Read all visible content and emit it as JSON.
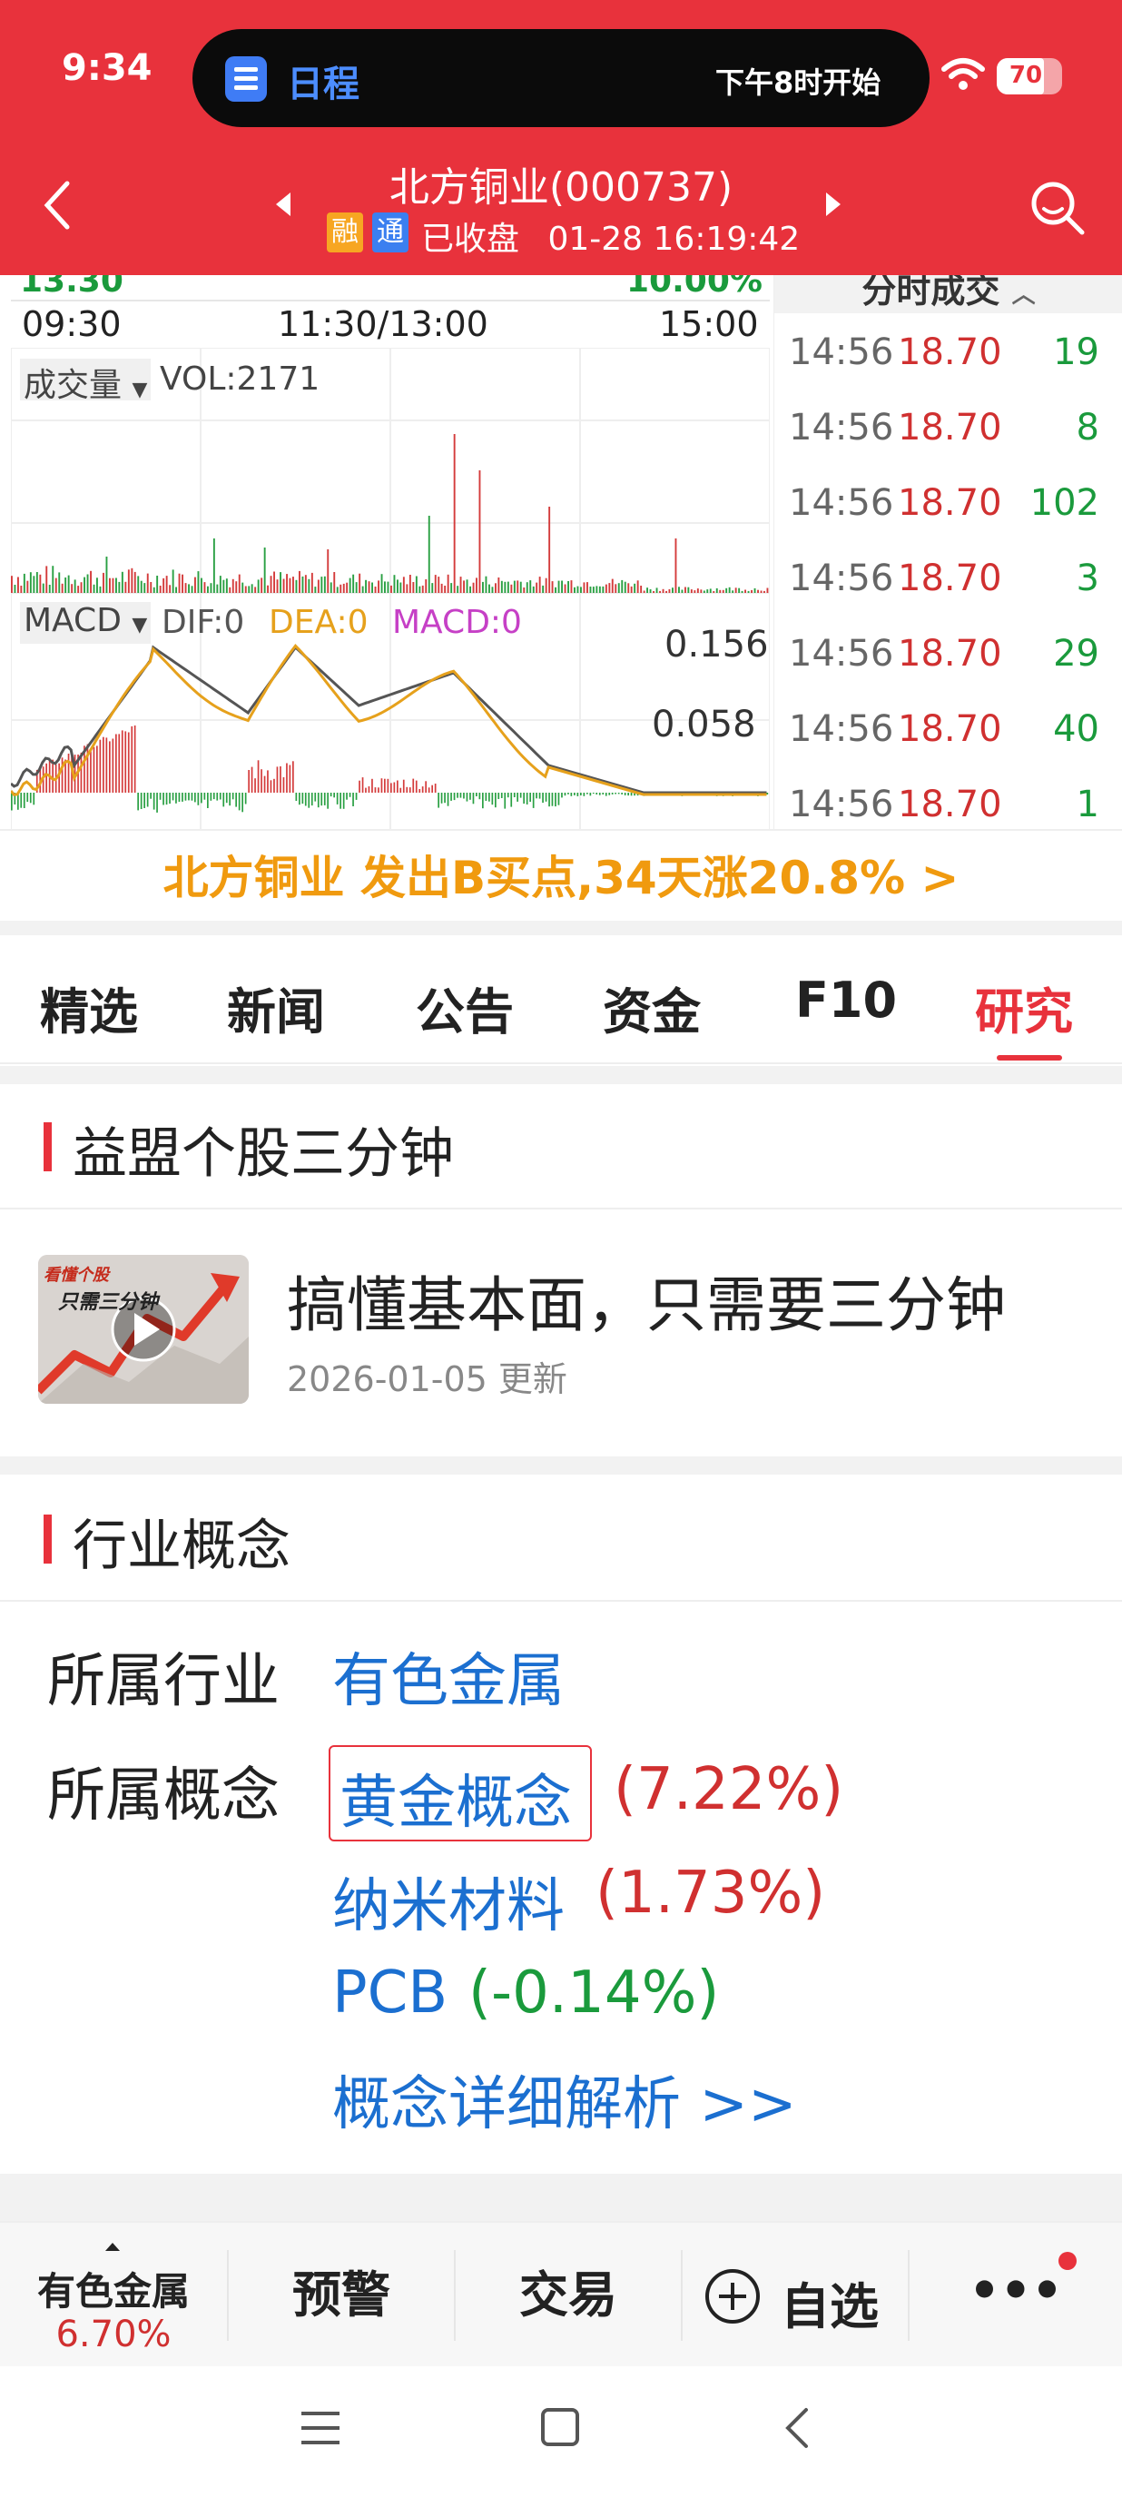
{
  "status_bar": {
    "time": "9:34",
    "island_app": "日程",
    "island_text": "下午8时开始",
    "battery": "70",
    "icons": [
      "calendar-icon",
      "wifi-icon",
      "battery-icon"
    ]
  },
  "header": {
    "stock_name": "北方铜业(000737)",
    "tag_margin": "融",
    "tag_connect": "通",
    "status": "已收盘",
    "datetime": "01-28 16:19:42"
  },
  "chart": {
    "partial_top_left": "13.30",
    "partial_top_right": "10.00%",
    "time_axis": [
      "09:30",
      "11:30/13:00",
      "15:00"
    ],
    "volume_label": "成交量",
    "volume_value": "VOL:2171",
    "macd_label": "MACD",
    "dif": "DIF:0",
    "dea": "DEA:0",
    "macd": "MACD:0",
    "macd_tick_high": "0.156",
    "macd_tick_mid": "0.058",
    "colors": {
      "up": "#d43b3b",
      "down": "#2aa043",
      "dif_line": "#555555",
      "dea_line": "#e6a11c",
      "macd_text": "#c640c6"
    }
  },
  "ticks": {
    "header": "分时成交",
    "rows": [
      {
        "time": "14:56",
        "price": "18.70",
        "vol": "19"
      },
      {
        "time": "14:56",
        "price": "18.70",
        "vol": "8"
      },
      {
        "time": "14:56",
        "price": "18.70",
        "vol": "102"
      },
      {
        "time": "14:56",
        "price": "18.70",
        "vol": "3"
      },
      {
        "time": "14:56",
        "price": "18.70",
        "vol": "29"
      },
      {
        "time": "14:56",
        "price": "18.70",
        "vol": "40"
      },
      {
        "time": "14:56",
        "price": "18.70",
        "vol": "1"
      }
    ]
  },
  "banner": "北方铜业 发出B买点,34天涨20.8% >",
  "tabs": [
    "精选",
    "新闻",
    "公告",
    "资金",
    "F10",
    "研究"
  ],
  "active_tab": "研究",
  "section_video": {
    "title": "益盟个股三分钟",
    "video_title": "搞懂基本面，只需要三分钟",
    "date": "2026-01-05 更新",
    "thumb_text_1": "看懂个股",
    "thumb_text_2": "只需三分钟"
  },
  "section_industry": {
    "title": "行业概念",
    "industry_label": "所属行业",
    "industry_value": "有色金属",
    "concept_label": "所属概念",
    "concepts": [
      {
        "name": "黄金概念",
        "pct": "(7.22%)"
      },
      {
        "name": "纳米材料",
        "pct": "(1.73%)"
      },
      {
        "name": "PCB",
        "pct": "(-0.14%)"
      }
    ],
    "detail_link": "概念详细解析 >>"
  },
  "bottom_bar": {
    "sector_name": "有色金属",
    "sector_pct": "6.70%",
    "alert": "预警",
    "trade": "交易",
    "watchlist": "自选",
    "more": "•••"
  }
}
